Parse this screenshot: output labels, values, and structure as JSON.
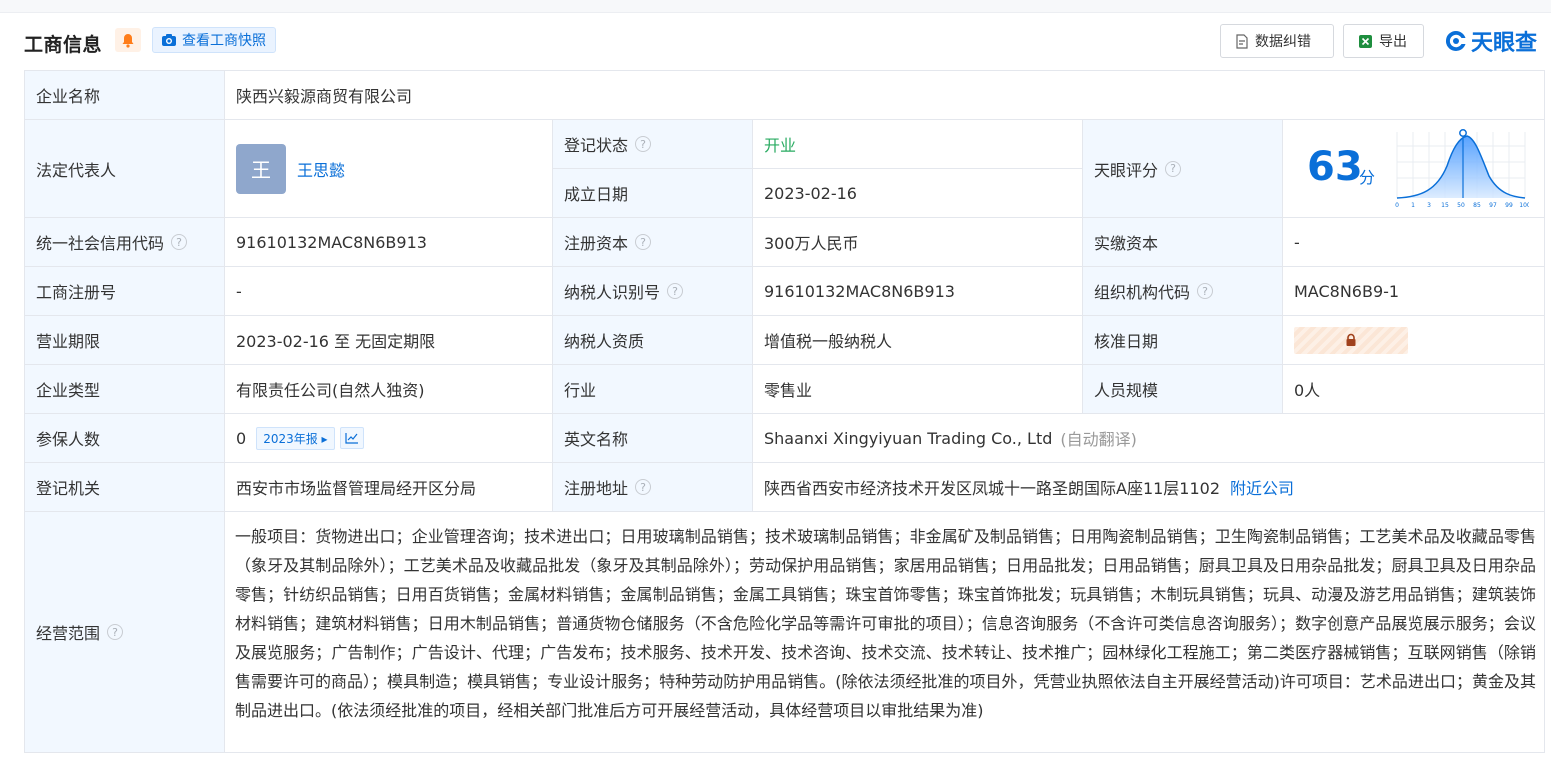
{
  "header": {
    "title": "工商信息",
    "snapshot_label": "查看工商快照",
    "correction_label": "数据纠错",
    "export_label": "导出",
    "logo_text": "天眼查"
  },
  "company": {
    "name_label": "企业名称",
    "name": "陕西兴毅源商贸有限公司",
    "legal_rep_label": "法定代表人",
    "legal_rep_avatar": "王",
    "legal_rep": "王思懿",
    "reg_status_label": "登记状态",
    "reg_status": "开业",
    "est_date_label": "成立日期",
    "est_date": "2023-02-16",
    "score_label": "天眼评分",
    "score_value": "63",
    "score_unit": "分",
    "credit_code_label": "统一社会信用代码",
    "credit_code": "91610132MAC8N6B913",
    "reg_capital_label": "注册资本",
    "reg_capital": "300万人民币",
    "paid_capital_label": "实缴资本",
    "paid_capital": "-",
    "reg_no_label": "工商注册号",
    "reg_no": "-",
    "taxpayer_id_label": "纳税人识别号",
    "taxpayer_id": "91610132MAC8N6B913",
    "org_code_label": "组织机构代码",
    "org_code": "MAC8N6B9-1",
    "term_label": "营业期限",
    "term": "2023-02-16 至 无固定期限",
    "taxpayer_qual_label": "纳税人资质",
    "taxpayer_qual": "增值税一般纳税人",
    "approval_date_label": "核准日期",
    "type_label": "企业类型",
    "type": "有限责任公司(自然人独资)",
    "industry_label": "行业",
    "industry": "零售业",
    "staff_size_label": "人员规模",
    "staff_size": "0人",
    "insured_label": "参保人数",
    "insured": "0",
    "insured_tag": "2023年报",
    "english_name_label": "英文名称",
    "english_name": "Shaanxi Xingyiyuan Trading Co., Ltd",
    "english_note": "(自动翻译)",
    "authority_label": "登记机关",
    "authority": "西安市市场监督管理局经开区分局",
    "address_label": "注册地址",
    "address": "陕西省西安市经济技术开发区凤城十一路圣朗国际A座11层1102",
    "nearby_label": "附近公司",
    "scope_label": "经营范围",
    "scope": "一般项目：货物进出口；企业管理咨询；技术进出口；日用玻璃制品销售；技术玻璃制品销售；非金属矿及制品销售；日用陶瓷制品销售；卫生陶瓷制品销售；工艺美术品及收藏品零售（象牙及其制品除外）；工艺美术品及收藏品批发（象牙及其制品除外）；劳动保护用品销售；家居用品销售；日用品批发；日用品销售；厨具卫具及日用杂品批发；厨具卫具及日用杂品零售；针纺织品销售；日用百货销售；金属材料销售；金属制品销售；金属工具销售；珠宝首饰零售；珠宝首饰批发；玩具销售；木制玩具销售；玩具、动漫及游艺用品销售；建筑装饰材料销售；建筑材料销售；日用木制品销售；普通货物仓储服务（不含危险化学品等需许可审批的项目）；信息咨询服务（不含许可类信息咨询服务）；数字创意产品展览展示服务；会议及展览服务；广告制作；广告设计、代理；广告发布；技术服务、技术开发、技术咨询、技术交流、技术转让、技术推广；园林绿化工程施工；第二类医疗器械销售；互联网销售（除销售需要许可的商品）；模具制造；模具销售；专业设计服务；特种劳动防护用品销售。(除依法须经批准的项目外，凭营业执照依法自主开展经营活动)许可项目：艺术品进出口；黄金及其制品进出口。(依法须经批准的项目，经相关部门批准后方可开展经营活动，具体经营项目以审批结果为准)"
  },
  "score_chart": {
    "ticks": [
      "0",
      "1",
      "3",
      "15",
      "50",
      "85",
      "97",
      "99",
      "100"
    ],
    "marker_value": 63
  },
  "colors": {
    "accent": "#0a6fd8",
    "label_bg": "#f2f8ff",
    "status_green": "#2aab62"
  },
  "icons": [
    "bell-icon",
    "camera-icon",
    "document-icon",
    "excel-icon",
    "tianyancha-logo-icon",
    "help-icon",
    "lock-icon",
    "trend-chart-icon"
  ]
}
